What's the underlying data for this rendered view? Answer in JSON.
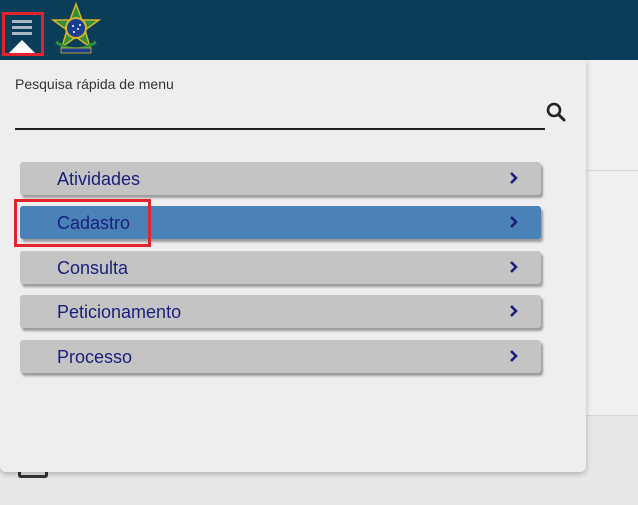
{
  "search": {
    "label": "Pesquisa rápida de menu",
    "placeholder": "",
    "value": ""
  },
  "menu": {
    "items": [
      {
        "label": "Atividades"
      },
      {
        "label": "Cadastro"
      },
      {
        "label": "Consulta"
      },
      {
        "label": "Peticionamento"
      },
      {
        "label": "Processo"
      }
    ],
    "active_item": "Cadastro"
  },
  "colors": {
    "topbar": "#0a3d58",
    "highlight": "#e3232d",
    "item_background": "#c4c4c4",
    "item_active_background": "#4a82b8",
    "item_text": "#1a1e7a"
  },
  "icons": {
    "menu_toggle": "hamburger-icon",
    "logo": "brazil-coat-of-arms-icon",
    "search": "search-icon",
    "chevron": "chevron-right-icon"
  }
}
